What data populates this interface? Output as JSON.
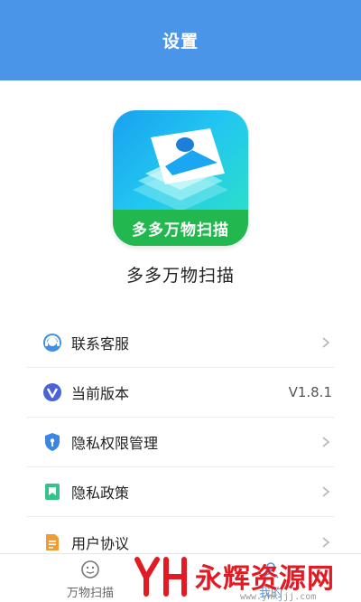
{
  "header": {
    "title": "设置"
  },
  "app": {
    "logo_band_text": "多多万物扫描",
    "name": "多多万物扫描"
  },
  "menu": {
    "items": [
      {
        "label": "联系客服",
        "value": "",
        "icon": "customer-service-icon"
      },
      {
        "label": "当前版本",
        "value": "V1.8.1",
        "icon": "version-icon"
      },
      {
        "label": "隐私权限管理",
        "value": "",
        "icon": "privacy-shield-icon"
      },
      {
        "label": "隐私政策",
        "value": "",
        "icon": "policy-bookmark-icon"
      },
      {
        "label": "用户协议",
        "value": "",
        "icon": "document-icon"
      }
    ]
  },
  "tabbar": {
    "tabs": [
      {
        "label": "万物扫描",
        "icon": "scan-face-icon"
      },
      {
        "label": "我的",
        "icon": "profile-icon"
      }
    ]
  },
  "watermark": {
    "text": "永辉资源网",
    "url": "www.yhkjjj.com"
  },
  "colors": {
    "header": "#4a95e8",
    "logo_band": "#22b84f",
    "watermark": "#e21a23"
  }
}
